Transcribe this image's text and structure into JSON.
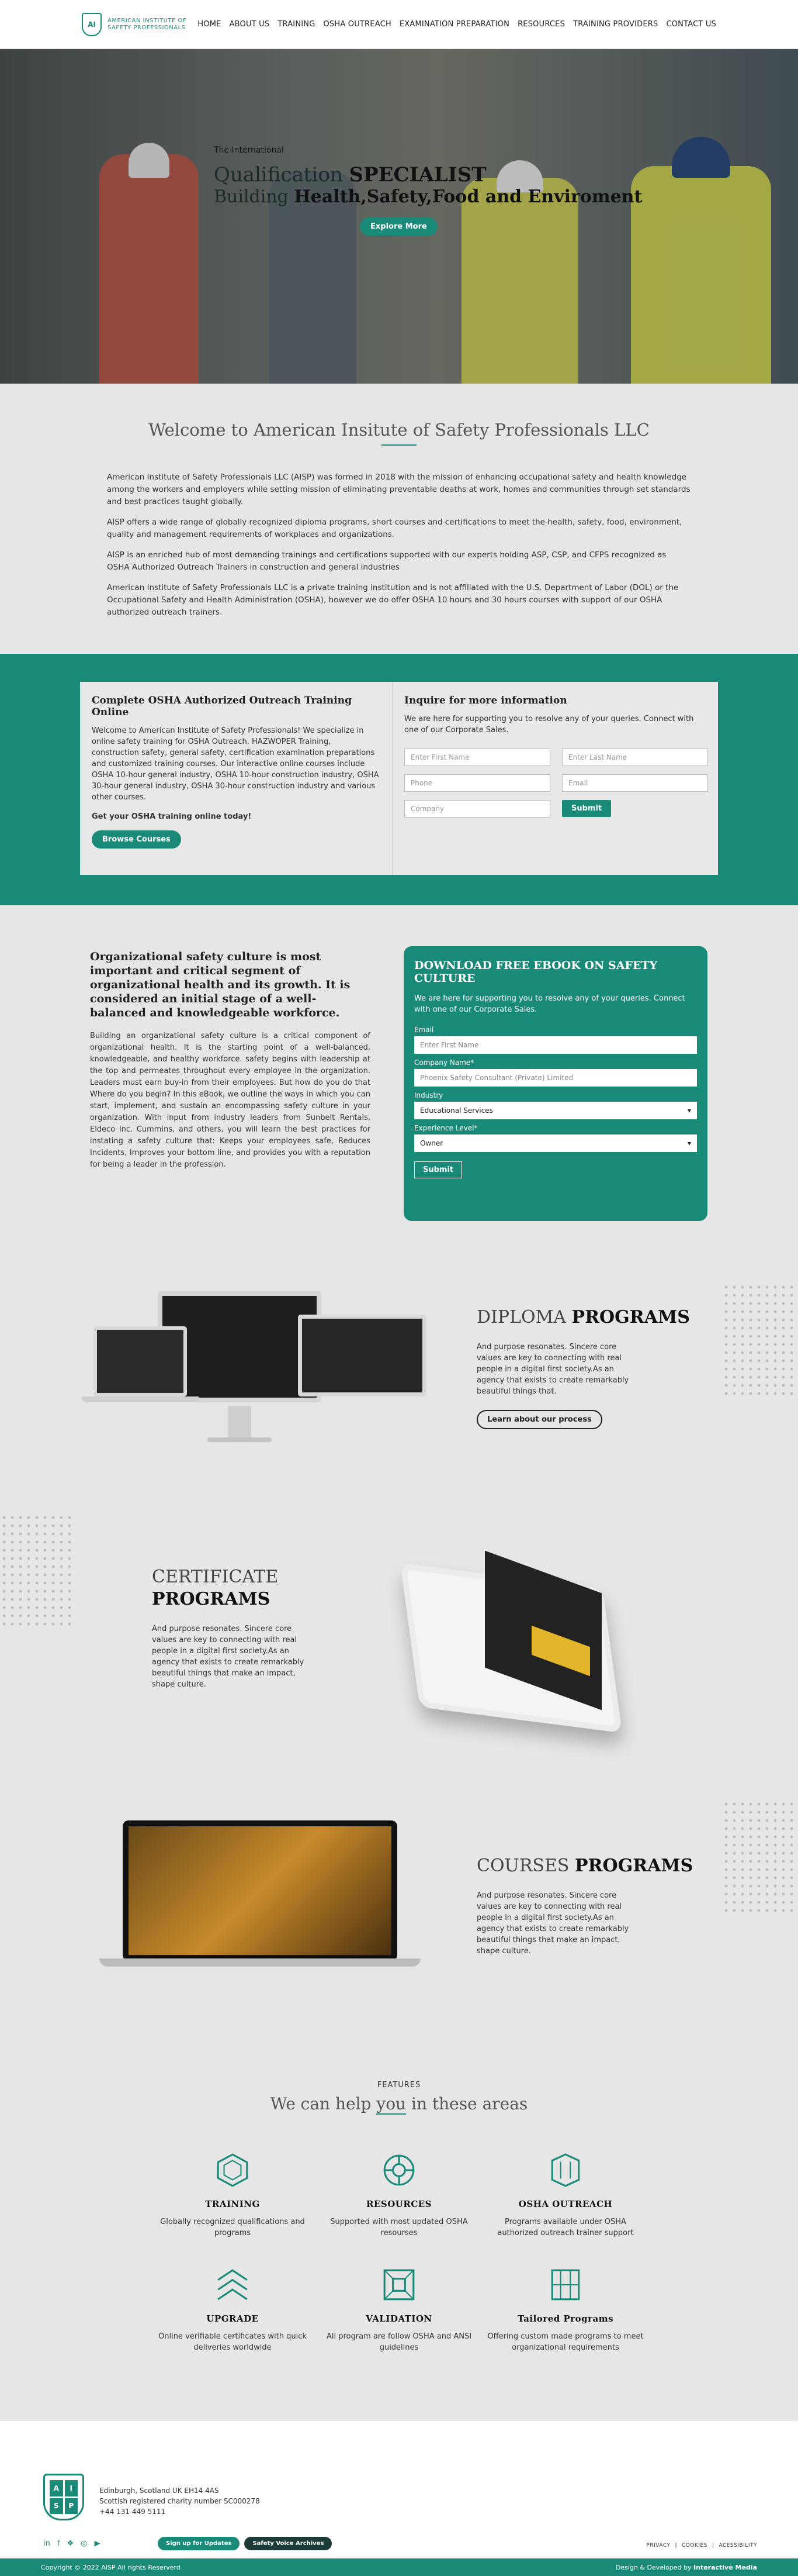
{
  "header": {
    "logo_text": "AMERICAN INSTITUTE OF SAFETY PROFESSIONALS",
    "nav": [
      "HOME",
      "ABOUT US",
      "TRAINING",
      "OSHA OUTREACH",
      "EXAMINATION PREPARATION",
      "RESOURCES",
      "TRAINING PROVIDERS",
      "CONTACT US"
    ]
  },
  "hero": {
    "small": "The International",
    "line1_a": "Qualification ",
    "line1_b": "SPECIALIST",
    "line2_a": "Building ",
    "line2_b": "Health,Safety,Food and Enviroment",
    "cta": "Explore More"
  },
  "welcome": {
    "title": "Welcome to American Insitute of Safety Professionals LLC",
    "paragraphs": [
      "American Institute of Safety Professionals LLC (AISP) was formed in 2018 with the mission of enhancing occupational safety and health knowledge among the workers and employers while setting mission of eliminating preventable deaths at work, homes and communities through set standards and best practices taught globally.",
      "AISP offers a wide range of globally recognized diploma programs, short courses and certifications to meet the health, safety, food, environment, quality and management requirements of workplaces and organizations.",
      "AISP is an enriched hub of most demanding trainings and certifications supported with our experts holding ASP, CSP, and CFPS recognized as OSHA Authorized Outreach Trainers in construction and general industries",
      "American Institute of Safety Professionals LLC is a private training institution and is not affiliated with the U.S. Department of Labor (DOL) or the Occupational Safety and Health Administration (OSHA), however we do offer OSHA 10 hours and 30 hours courses with support of our OSHA authorized outreach trainers."
    ]
  },
  "osha": {
    "title": "Complete OSHA Authorized Outreach Training Online",
    "text": "Welcome to American Institute of Safety Professionals! We specialize in online safety training for OSHA Outreach, HAZWOPER Training, construction safety, general safety, certification examination preparations and customized training courses. Our interactive online courses include OSHA 10-hour general industry, OSHA 10-hour construction industry, OSHA 30-hour general industry, OSHA 30-hour construction industry and various other courses.",
    "cta_text": "Get your OSHA training online today!",
    "button": "Browse Courses",
    "inquire_title": "Inquire for more information",
    "inquire_text": "We are here for supporting you to resolve any of your queries. Connect with one of our Corporate Sales.",
    "ph_first": "Enter First Name",
    "ph_last": "Enter Last Name",
    "ph_phone": "Phone",
    "ph_email": "Email",
    "ph_company": "Company",
    "submit": "Submit"
  },
  "ebook": {
    "heading": "Organizational safety culture is most important and critical segment of organizational health and its growth. It is considered an initial stage of a well-balanced and knowledgeable workforce.",
    "text": "Building an organizational safety culture is a critical component of organizational health. It is the starting point of a well-balanced, knowledgeable, and healthy workforce. safety begins with leadership at the top and permeates throughout every employee in the organization. Leaders must earn buy-in from their employees. But how do you do that Where do you begin? In this eBook, we outline the ways in which you can start, implement, and sustain an encompassing safety culture in your organization. With input from industry leaders from Sunbelt Rentals, Eldeco Inc. Cummins, and others, you will learn the best practices for instating a safety culture that: Keeps your employees safe, Reduces Incidents, Improves your bottom line, and provides you with a reputation for being a leader in the profession.",
    "form_title": "DOWNLOAD FREE EBOOK ON SAFETY CULTURE",
    "form_text": "We are here for supporting you to resolve any of your queries. Connect with one of our Corporate Sales.",
    "email_label": "Email",
    "email_ph": "Enter First Name",
    "company_label": "Company Name*",
    "company_ph": "Phoenix Safety Consultant (Private) Limited",
    "industry_label": "Industry",
    "industry_value": "Educational Services",
    "experience_label": "Experience Level*",
    "experience_value": "Owner",
    "submit": "Submit"
  },
  "programs": {
    "diploma": {
      "a": "DIPLOMA ",
      "b": "PROGRAMS",
      "text": "And purpose resonates. Sincere core values are key to connecting with real people in a digital first society.As an agency that exists to create remarkably beautiful things that.",
      "button": "Learn about our process"
    },
    "certificate": {
      "a": "CERTIFICATE",
      "b": "PROGRAMS",
      "text": "And purpose resonates. Sincere core values are key to connecting with real people in a digital first society.As an agency that exists to create remarkably beautiful things that make an impact, shape culture."
    },
    "courses": {
      "a": "COURSES ",
      "b": "PROGRAMS",
      "text": "And purpose resonates. Sincere core values are key to connecting with real people in a digital first society.As an agency that exists to create remarkably beautiful things that make an impact, shape culture."
    }
  },
  "features": {
    "small": "FEATURES",
    "title_a": "We can help ",
    "title_b": "you",
    "title_c": " in these areas",
    "items": [
      {
        "title": "TRAINING",
        "text": "Globally recognized qualifications and programs"
      },
      {
        "title": "RESOURCES",
        "text": "Supported with most updated OSHA resourses"
      },
      {
        "title": "OSHA OUTREACH",
        "text": "Programs available under OSHA authorized outreach trainer support"
      },
      {
        "title": "UPGRADE",
        "text": "Online verifiable certificates with quick deliveries worldwide"
      },
      {
        "title": "VALIDATION",
        "text": "All program are follow OSHA and ANSI guidelines"
      },
      {
        "title": "Tailored Programs",
        "text": "Offering custom made programs to meet organizational requirements"
      }
    ]
  },
  "footer": {
    "address1": "Edinburgh, Scotland UK EH14 4AS",
    "address2": "Scottish registered charity number SC000278",
    "phone": "+44 131 449 5111",
    "btn1": "Sign up for Updates",
    "btn2": "Safety Voice Archives",
    "links": [
      "PRIVACY",
      "COOKIES",
      "ACESSIBILITY"
    ],
    "copyright": "Copyright © 2022 AISP All rights Reserverd",
    "design": "Design & Developed by",
    "design_by": "Interactive Media"
  }
}
